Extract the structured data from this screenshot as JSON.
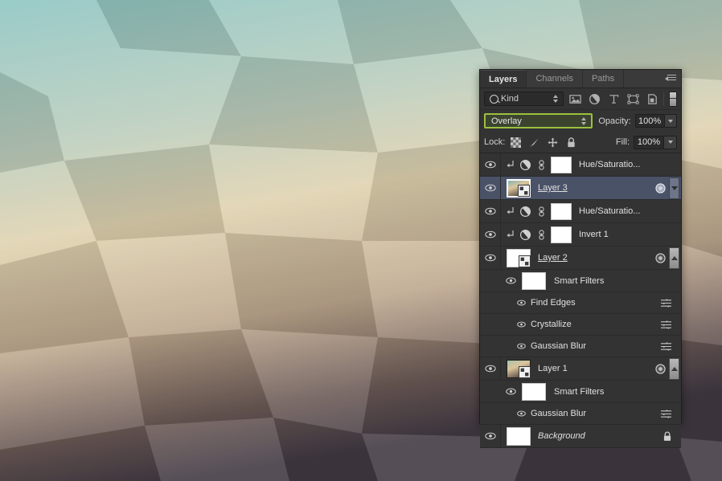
{
  "app": {
    "panel_title": "Layers"
  },
  "tabs": [
    {
      "label": "Layers",
      "active": true
    },
    {
      "label": "Channels",
      "active": false
    },
    {
      "label": "Paths",
      "active": false
    }
  ],
  "panel_menu_icon": "panel-menu-icon",
  "filter_bar": {
    "kind_label": "Kind",
    "search_icon": "search-icon",
    "type_filter_icons": [
      "pixel-layers-icon",
      "adjustment-layers-icon",
      "type-layers-icon",
      "shape-layers-icon",
      "smart-object-layers-icon"
    ],
    "filter_toggle_icon": "filter-enable-toggle"
  },
  "blend_bar": {
    "blend_mode": "Overlay",
    "blend_highlight_border": "#9cc03e",
    "blend_highlight_fill": "#3c4430",
    "opacity_label": "Opacity:",
    "opacity_value": "100%"
  },
  "lock_bar": {
    "lock_label": "Lock:",
    "lock_icons": [
      "lock-transparent-pixels-icon",
      "lock-image-pixels-icon",
      "lock-position-icon",
      "lock-all-icon"
    ],
    "fill_label": "Fill:",
    "fill_value": "100%"
  },
  "layers": [
    {
      "name": "Hue/Saturatio...",
      "type": "adjustment",
      "visible": true,
      "clipped": true,
      "selected": false,
      "linked": true,
      "mask": true
    },
    {
      "name": "Layer 3",
      "type": "smart-object",
      "visible": true,
      "selected": true,
      "underline": true,
      "has_fx": true,
      "expander": "down",
      "thumb_colors": [
        "#7ea0a8",
        "#d8c49a",
        "#6f5f52"
      ]
    },
    {
      "name": "Hue/Saturatio...",
      "type": "adjustment",
      "visible": true,
      "clipped": true,
      "selected": false,
      "linked": true,
      "mask": true
    },
    {
      "name": "Invert 1",
      "type": "adjustment",
      "visible": true,
      "clipped": true,
      "selected": false,
      "linked": true,
      "mask": true
    },
    {
      "name": "Layer 2",
      "type": "smart-object",
      "visible": true,
      "selected": false,
      "underline": true,
      "has_fx": true,
      "expander": "up",
      "thumb_colors": [
        "#ffffff",
        "#ffffff",
        "#ffffff"
      ],
      "smart_filters": {
        "label": "Smart Filters",
        "visible": true,
        "filters": [
          {
            "name": "Find Edges",
            "visible": true
          },
          {
            "name": "Crystallize",
            "visible": true
          },
          {
            "name": "Gaussian Blur",
            "visible": true
          }
        ]
      }
    },
    {
      "name": "Layer 1",
      "type": "smart-object",
      "visible": true,
      "selected": false,
      "underline": false,
      "has_fx": true,
      "expander": "up",
      "thumb_colors": [
        "#9fb9a8",
        "#d9c29c",
        "#6b5a4e"
      ],
      "smart_filters": {
        "label": "Smart Filters",
        "visible": true,
        "filters": [
          {
            "name": "Gaussian Blur",
            "visible": true
          }
        ]
      }
    },
    {
      "name": "Background",
      "type": "background",
      "visible": true,
      "selected": false,
      "italic": true,
      "locked": true
    }
  ],
  "wallpaper": {
    "description": "low-poly gradient wallpaper",
    "top_color": "#8dc3c0",
    "mid_color": "#e3d6b4",
    "bottom_color": "#4a4148"
  }
}
